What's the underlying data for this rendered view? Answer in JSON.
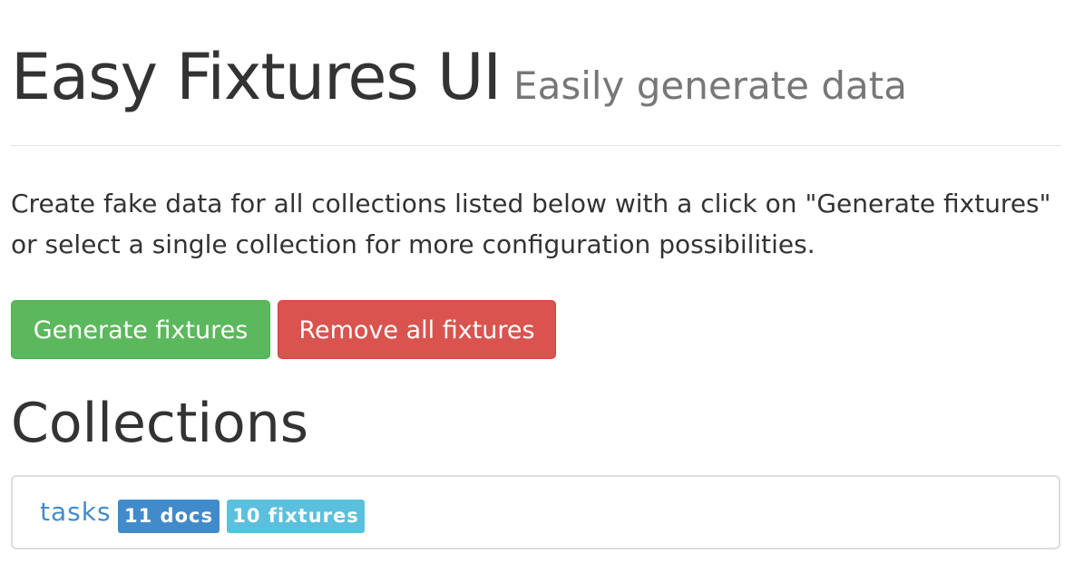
{
  "header": {
    "title": "Easy Fixtures UI",
    "subtitle": "Easily generate data"
  },
  "intro": {
    "text": "Create fake data for all collections listed below with a click on \"Generate fixtures\" or select a single collection for more configuration possibilities."
  },
  "actions": {
    "generate_label": "Generate fixtures",
    "remove_label": "Remove all fixtures"
  },
  "collections": {
    "heading": "Collections",
    "items": [
      {
        "name": "tasks",
        "docs_badge": "11 docs",
        "fixtures_badge": "10 fixtures"
      }
    ]
  },
  "colors": {
    "generate_button": "#5cb85c",
    "remove_button": "#d9534f",
    "link": "#428bca",
    "docs_badge": "#428bca",
    "fixtures_badge": "#5bc0de"
  }
}
